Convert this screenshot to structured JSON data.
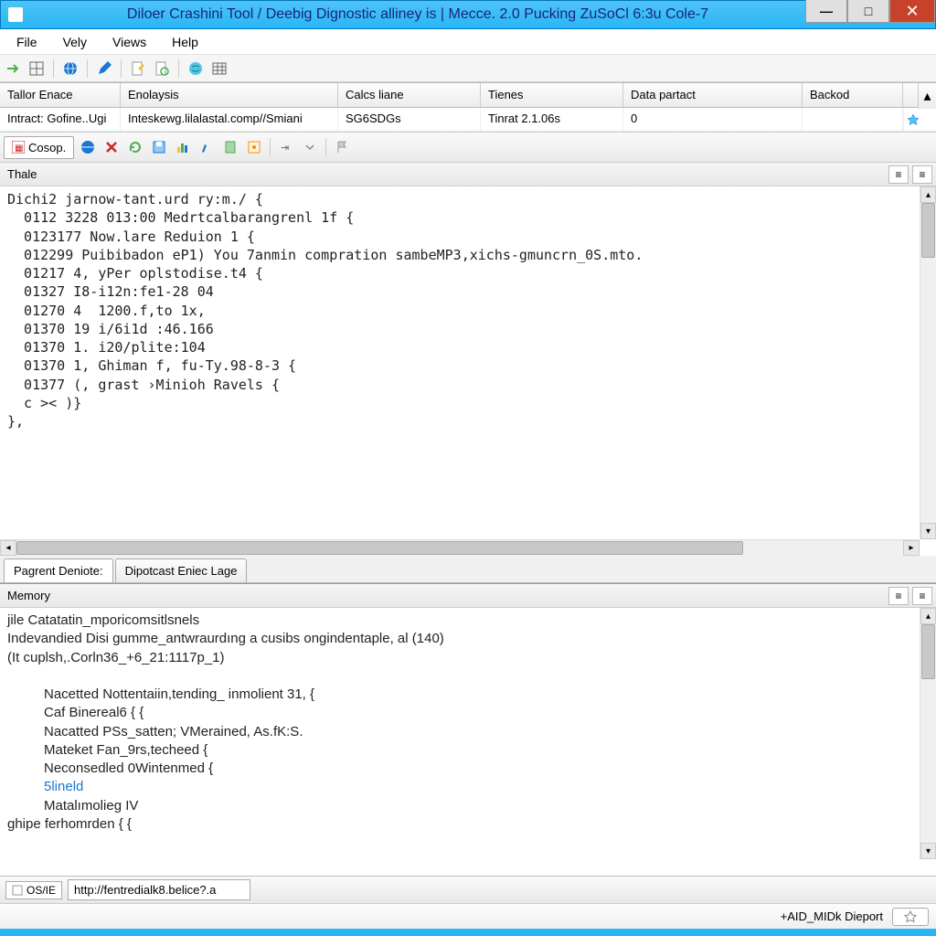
{
  "window": {
    "title": "Diloer Crashini Tool  /  Deebig Dignostic alliney is | Mecce. 2.0 Pucking ZuSoCl 6:3u Cole-7"
  },
  "menubar": [
    "File",
    "Vely",
    "Views",
    "Help"
  ],
  "grid": {
    "headers": [
      "Tallor Enace",
      "Enolaysis",
      "Calcs liane",
      "Tienes",
      "Data partact",
      "Backod"
    ],
    "row": [
      "Intract: Gofine..Ugi",
      "Inteskewg.lilalastal.comp//Smiani",
      "SG6SDGs",
      "Tinrat 2.1.06s",
      "0",
      ""
    ]
  },
  "toolbar2": {
    "tab_label": "Cosop."
  },
  "panel1": {
    "title": "Thale",
    "code": "Dichi2 jarnow-tant.urd ry:m./ {\n  0112 3228 013:00 Medrtcalbarangrenl 1f {\n  0123177 Now.lare Reduion 1 {\n  012299 Puibibadon eP1) You 7anmin compration sambeMP3,xichs-gmuncrn_0S.mto.\n  01217 4, yPer oplstodise.t4 {\n  01327 I8-i12n:fe1-28 04\n  01270 4  1200.f,to 1x,\n  01370 19 i/6i1d :46.166\n  01370 1. i20/plite:104\n  01370 1, Ghiman f, fu-Ty.98-8-3 {\n  01377 (, grast ›Minioh Ravels {\n  c >< )}\n},"
  },
  "tabs": [
    "Pagrent Deniote:",
    "Dipotcast Eniec Lage"
  ],
  "panel2": {
    "title": "Memory",
    "code_lines": [
      {
        "t": "jile Catatatin_mporicomsitlsnels",
        "link": false,
        "indent": 0
      },
      {
        "t": "Indevandied Disi gumme_antwraurdıng a cusibs ongindentaple, al (140)",
        "link": false,
        "indent": 0
      },
      {
        "t": "(It cuplsh,.Corln36_+6_21:1117p_1)",
        "link": false,
        "indent": 0
      },
      {
        "t": "",
        "link": false,
        "indent": 0
      },
      {
        "t": "Nacetted Nottentaiin,tending_ inmolient 31, {",
        "link": false,
        "indent": 1
      },
      {
        "t": "Caf Binereal6 { {",
        "link": false,
        "indent": 1
      },
      {
        "t": "Nacatted PSs_satten; VMerained, As.fK:S.",
        "link": false,
        "indent": 1
      },
      {
        "t": "Mateket Fan_9rs,techeed {",
        "link": false,
        "indent": 1
      },
      {
        "t": "Neconsedled 0Wintenmed {",
        "link": false,
        "indent": 1
      },
      {
        "t": "5lineld",
        "link": true,
        "indent": 1
      },
      {
        "t": "Matalımolieg IV",
        "link": false,
        "indent": 1
      },
      {
        "t": "ghipe ferhomrden { {",
        "link": false,
        "indent": 0
      }
    ]
  },
  "status": {
    "badge": "OS/IE",
    "url": "http://fentredialk8.belice?.a",
    "right": "+AID_MIDk Dieport"
  }
}
